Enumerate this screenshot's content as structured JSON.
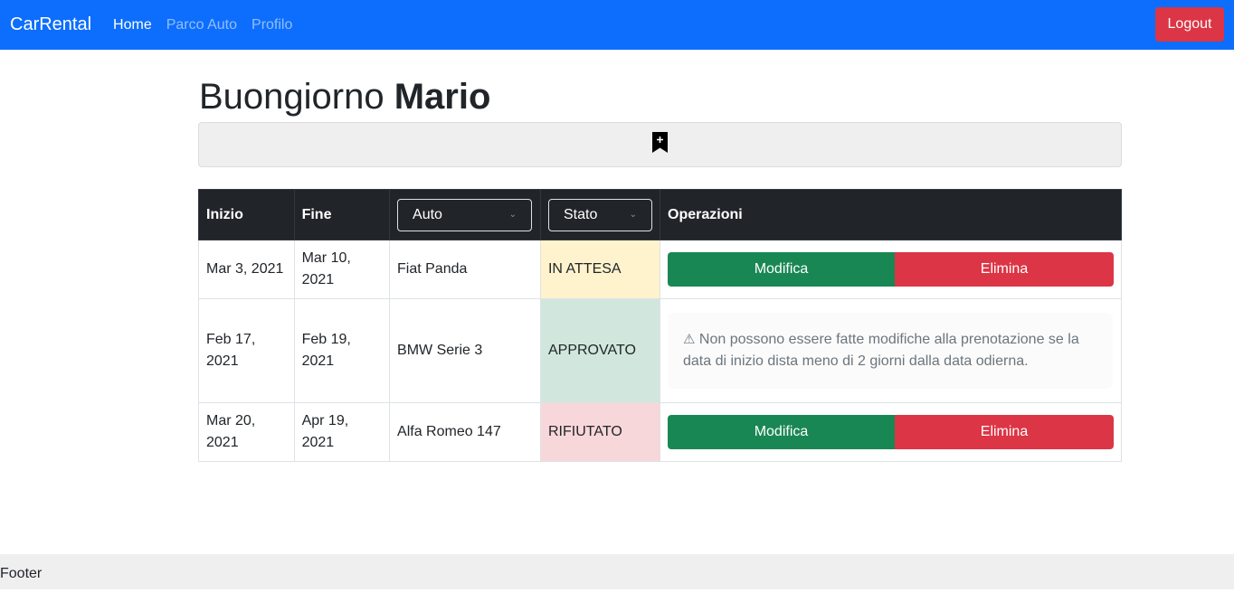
{
  "navbar": {
    "brand": "CarRental",
    "links": [
      "Home",
      "Parco Auto",
      "Profilo"
    ],
    "logout": "Logout"
  },
  "greeting": {
    "prefix": "Buongiorno",
    "name": "Mario"
  },
  "add_bar": {
    "icon": "bookmark-plus-icon"
  },
  "table": {
    "headers": {
      "start": "Inizio",
      "end": "Fine",
      "car": "Auto",
      "status": "Stato",
      "operations": "Operazioni"
    },
    "rows": [
      {
        "start": "Mar 3, 2021",
        "end": "Mar 10, 2021",
        "car": "Fiat Panda",
        "status": "IN ATTESA",
        "status_color": "#fff3cd",
        "edit": "Modifica",
        "delete": "Elimina"
      },
      {
        "start": "Feb 17, 2021",
        "end": "Feb 19, 2021",
        "car": "BMW Serie 3",
        "status": "APPROVATO",
        "status_color": "#d1e7dd",
        "notice": "Non possono essere fatte modifiche alla prenotazione se la data di inizio dista meno di 2 giorni dalla data odierna."
      },
      {
        "start": "Mar 20, 2021",
        "end": "Apr 19, 2021",
        "car": "Alfa Romeo 147",
        "status": "RIFIUTATO",
        "status_color": "#f8d7da",
        "edit": "Modifica",
        "delete": "Elimina"
      }
    ]
  },
  "footer": {
    "text": "Footer"
  },
  "colors": {
    "primary": "#0d6efd",
    "danger": "#dc3545",
    "success": "#198754",
    "dark": "#212529"
  }
}
